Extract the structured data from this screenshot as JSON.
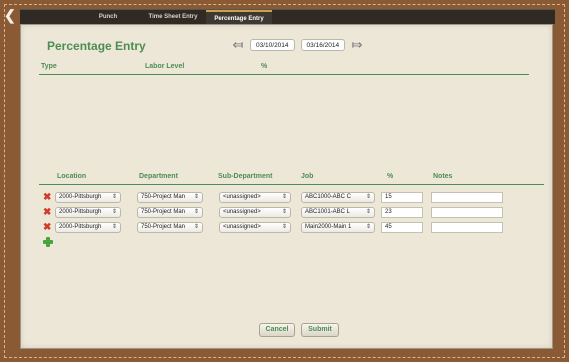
{
  "tabs": [
    {
      "label": "Punch",
      "active": false
    },
    {
      "label": "Time Sheet Entry",
      "active": false
    },
    {
      "label": "Percentage Entry",
      "active": true
    }
  ],
  "page": {
    "title": "Percentage Entry",
    "start_date": "03/10/2014",
    "end_date": "03/16/2014"
  },
  "top_table": {
    "headers": [
      "Type",
      "Labor Level",
      "%"
    ]
  },
  "bottom_table": {
    "headers": [
      "Location",
      "Department",
      "Sub-Department",
      "Job",
      "%",
      "Notes"
    ],
    "rows": [
      {
        "location": "2000-Pittsburgh",
        "department": "750-Project Man",
        "sub_department": "<unassigned>",
        "job": "ABC1000-ABC C",
        "percent": "15",
        "notes": ""
      },
      {
        "location": "2000-Pittsburgh",
        "department": "750-Project Man",
        "sub_department": "<unassigned>",
        "job": "ABC1001-ABC L",
        "percent": "23",
        "notes": ""
      },
      {
        "location": "2000-Pittsburgh",
        "department": "750-Project Man",
        "sub_department": "<unassigned>",
        "job": "Main2000-Main 1",
        "percent": "45",
        "notes": ""
      }
    ]
  },
  "buttons": {
    "cancel": "Cancel",
    "submit": "Submit"
  },
  "colors": {
    "accent": "#4d8d55",
    "delete": "#d23b2a",
    "add": "#49a43e",
    "frame": "#8a5a34",
    "panel": "#ede7d7"
  },
  "icons": {
    "back": "back-chevron-icon",
    "prev": "left-arrow-icon",
    "next": "right-arrow-icon",
    "delete": "delete-x-icon",
    "add": "add-plus-icon"
  }
}
